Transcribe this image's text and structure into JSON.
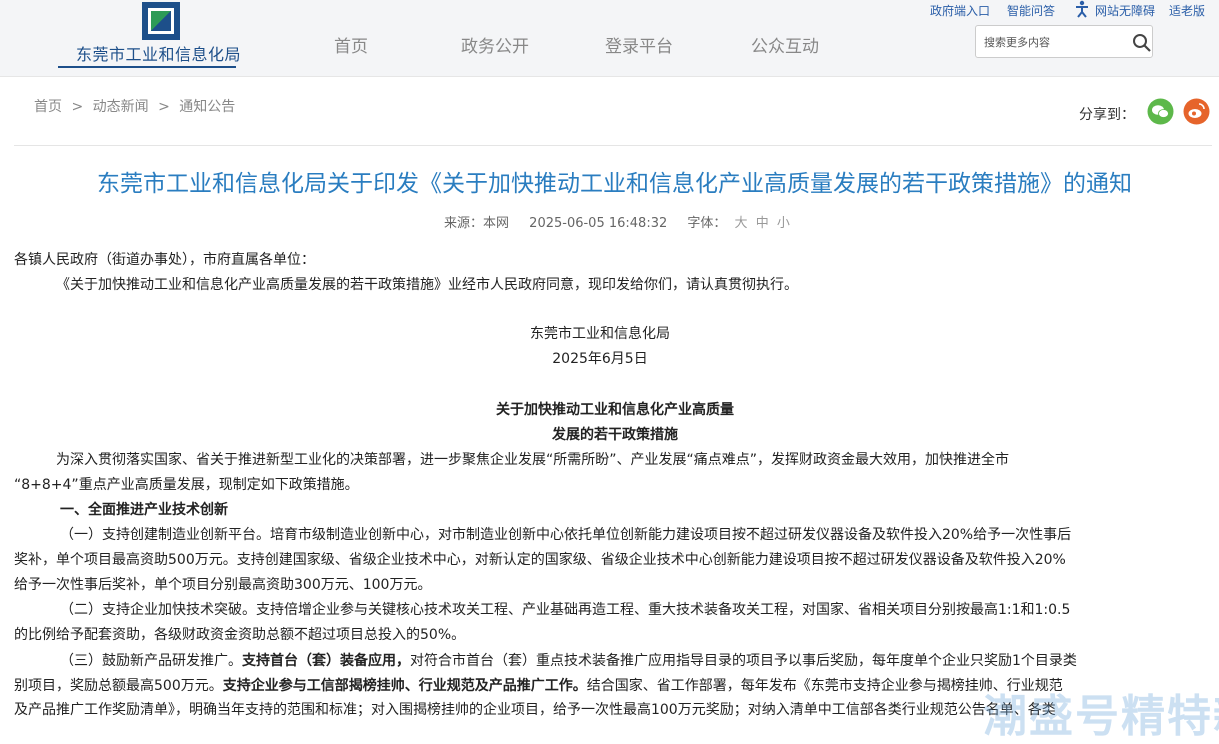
{
  "header": {
    "org_name": "东莞市工业和信息化局",
    "nav": [
      "首页",
      "政务公开",
      "登录平台",
      "公众互动"
    ],
    "top_links": {
      "mailbox": "政府端入口",
      "assistant": "智能问答",
      "accessibility": "网站无障碍",
      "elder": "适老版"
    },
    "search_placeholder": "搜索更多内容"
  },
  "breadcrumb": [
    "首页",
    ">",
    "动态新闻",
    ">",
    "通知公告"
  ],
  "share": {
    "label": "分享到：",
    "colors": {
      "wechat": "#5db84a",
      "weibo": "#e6642b"
    }
  },
  "article": {
    "title": "东莞市工业和信息化局关于印发《关于加快推动工业和信息化产业高质量发展的若干政策措施》的通知",
    "meta": {
      "source_label": "来源：",
      "source": "本网",
      "datetime": "2025-06-05 16:48:32",
      "font_label": "字体：",
      "sizes": [
        "大",
        "中",
        "小"
      ]
    },
    "salutation": "各镇人民政府（街道办事处），市府直属各单位：",
    "intro": "《关于加快推动工业和信息化产业高质量发展的若干政策措施》业经市人民政府同意，现印发给你们，请认真贯彻执行。",
    "signature_org": "东莞市工业和信息化局",
    "signature_date": "2025年6月5日",
    "doc_title_1": "关于加快推动工业和信息化产业高质量",
    "doc_title_2": "发展的若干政策措施",
    "para1_line1": "为深入贯彻落实国家、省关于推进新型工业化的决策部署，进一步聚焦企业发展“所需所盼”、产业发展“痛点难点”，发挥财政资金最大效用，加快推进全市",
    "para1_line2": "“8+8+4”重点产业高质量发展，现制定如下政策措施。",
    "section1": "一、全面推进产业技术创新",
    "item1_line1": "（一）支持创建制造业创新平台。培育市级制造业创新中心，对市制造业创新中心依托单位创新能力建设项目按不超过研发仪器设备及软件投入20%给予一次性事后",
    "item1_line2": "奖补，单个项目最高资助500万元。支持创建国家级、省级企业技术中心，对新认定的国家级、省级企业技术中心创新能力建设项目按不超过研发仪器设备及软件投入20%",
    "item1_line3": "给予一次性事后奖补，单个项目分别最高资助300万元、100万元。",
    "item2_line1": "（二）支持企业加快技术突破。支持倍增企业参与关键核心技术攻关工程、产业基础再造工程、重大技术装备攻关工程，对国家、省相关项目分别按最高1:1和1:0.5",
    "item2_line2": "的比例给予配套资助，各级财政资金资助总额不超过项目总投入的50%。",
    "item3_a": "（三）鼓励新产品研发推广。",
    "item3_b": "支持首台（套）装备应用，",
    "item3_c": "对符合市首台（套）重点技术装备推广应用指导目录的项目予以事后奖励，每年度单个企业只奖励1个目录类",
    "item3_d": "别项目，奖励总额最高500万元。",
    "item3_e": "支持企业参与工信部揭榜挂帅、行业规范及产品推广工作。",
    "item3_f": "结合国家、省工作部署，每年发布《东莞市支持企业参与揭榜挂帅、行业规范",
    "item3_g": "及产品推广工作奖励清单》，明确当年支持的范围和标准；对入围揭榜挂帅的企业项目，给予一次性最高100万元奖励；对纳入清单中工信部各类行业规范公告名单、各类",
    "watermark": "潮盛号精特新"
  }
}
